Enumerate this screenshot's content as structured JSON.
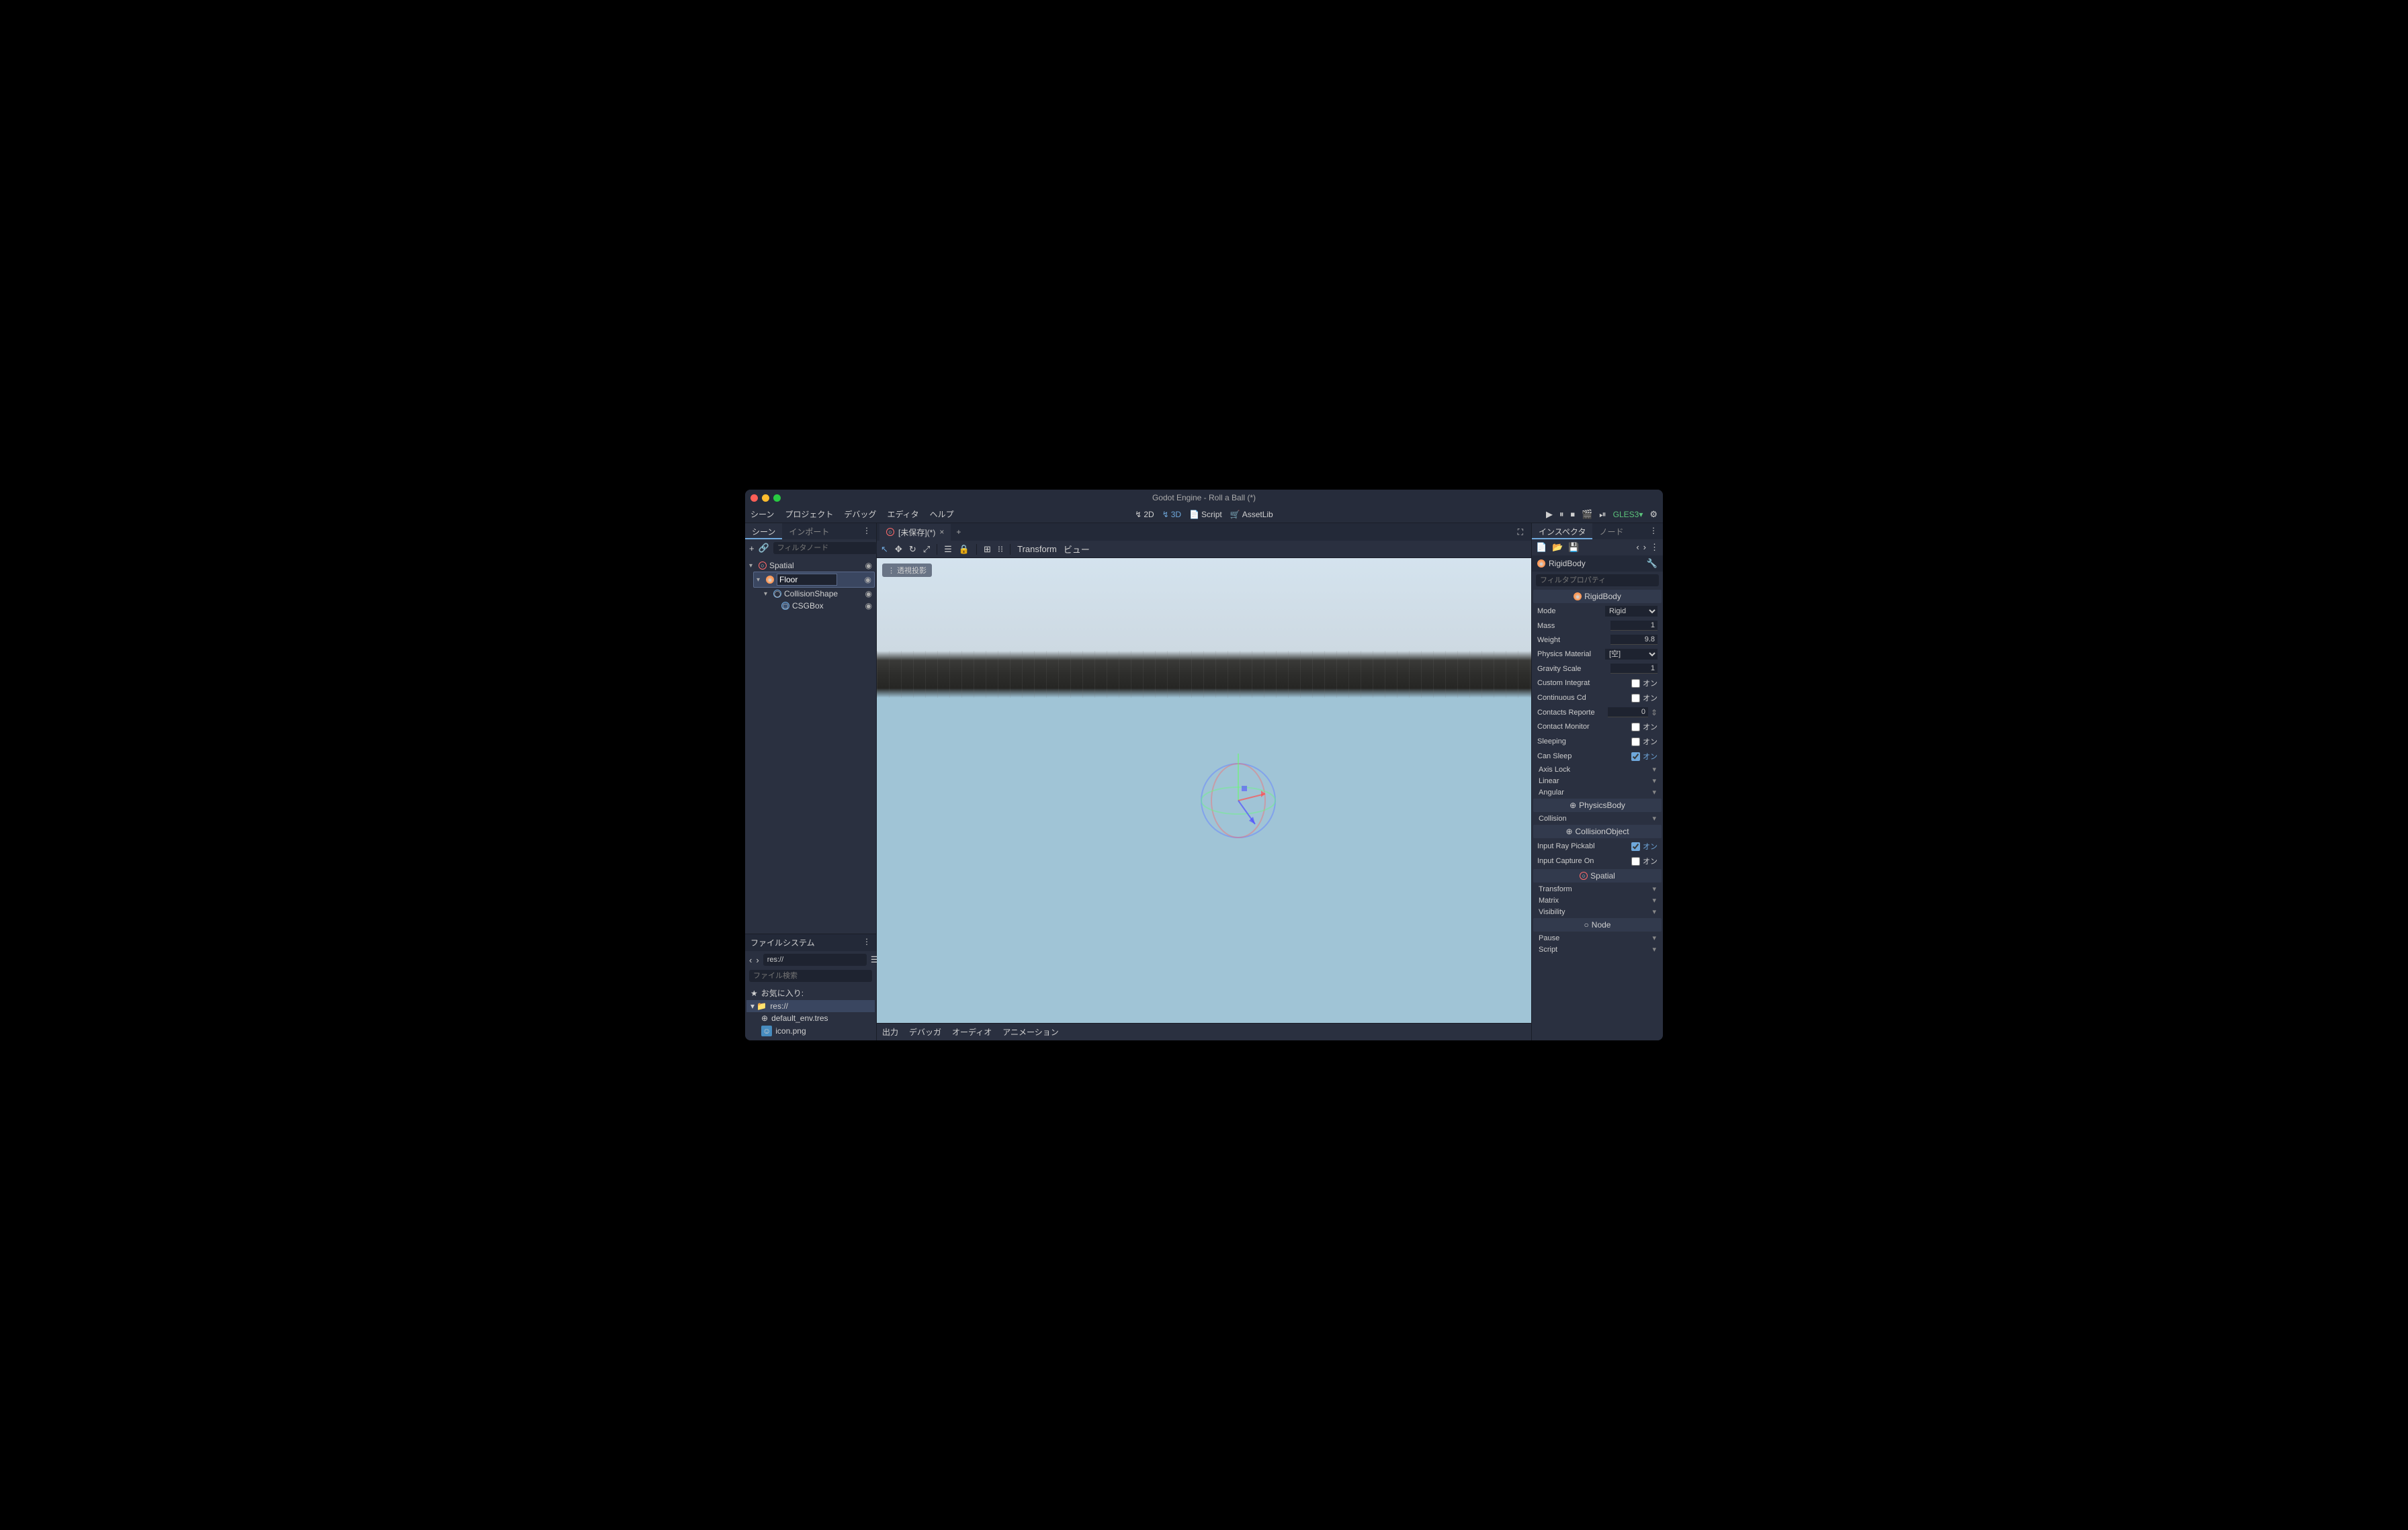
{
  "window_title": "Godot Engine - Roll a Ball (*)",
  "menubar": {
    "scene": "シーン",
    "project": "プロジェクト",
    "debug": "デバッグ",
    "editor": "エディタ",
    "help": "ヘルプ"
  },
  "workspace": {
    "w2d": "2D",
    "w3d": "3D",
    "script": "Script",
    "assetlib": "AssetLib"
  },
  "renderer": "GLES3",
  "left_tabs": {
    "scene": "シーン",
    "import": "インポート"
  },
  "scene_toolbar": {
    "filter_placeholder": "フィルタノード"
  },
  "scenetree": {
    "root": "Spatial",
    "child1": "Floor",
    "child2": "CollisionShape",
    "child3": "CSGBox"
  },
  "filesystem": {
    "title": "ファイルシステム",
    "path": "res://",
    "search_placeholder": "ファイル検索",
    "favorites": "お気に入り:",
    "root": "res://",
    "file1": "default_env.tres",
    "file2": "icon.png"
  },
  "scene_tab": {
    "name": "[未保存](*)"
  },
  "viewport_toolbar": {
    "transform": "Transform",
    "view": "ビュー"
  },
  "viewport_label": "透視投影",
  "bottom": {
    "output": "出力",
    "debugger": "デバッガ",
    "audio": "オーディオ",
    "animation": "アニメーション"
  },
  "right_tabs": {
    "inspector": "インスペクタ",
    "node": "ノード"
  },
  "inspector": {
    "class_name": "RigidBody",
    "filter_placeholder": "フィルタプロパティ",
    "section_rigidbody": "RigidBody",
    "mode": {
      "label": "Mode",
      "value": "Rigid"
    },
    "mass": {
      "label": "Mass",
      "value": "1"
    },
    "weight": {
      "label": "Weight",
      "value": "9.8"
    },
    "physmat": {
      "label": "Physics Material",
      "value": "[空]"
    },
    "gravity": {
      "label": "Gravity Scale",
      "value": "1"
    },
    "custom_int": {
      "label": "Custom Integrat",
      "on": "オン"
    },
    "cont_cd": {
      "label": "Continuous Cd",
      "on": "オン"
    },
    "contacts": {
      "label": "Contacts Reporte",
      "value": "0"
    },
    "contact_mon": {
      "label": "Contact Monitor",
      "on": "オン"
    },
    "sleeping": {
      "label": "Sleeping",
      "on": "オン"
    },
    "can_sleep": {
      "label": "Can Sleep",
      "on": "オン"
    },
    "axis_lock": "Axis Lock",
    "linear": "Linear",
    "angular": "Angular",
    "section_physicsbody": "PhysicsBody",
    "collision": "Collision",
    "section_collisionobject": "CollisionObject",
    "input_ray": {
      "label": "Input Ray Pickabl",
      "on": "オン"
    },
    "input_cap": {
      "label": "Input Capture On",
      "on": "オン"
    },
    "section_spatial": "Spatial",
    "transform": "Transform",
    "matrix": "Matrix",
    "visibility": "Visibility",
    "section_node": "Node",
    "pause": "Pause",
    "scriptp": "Script"
  }
}
